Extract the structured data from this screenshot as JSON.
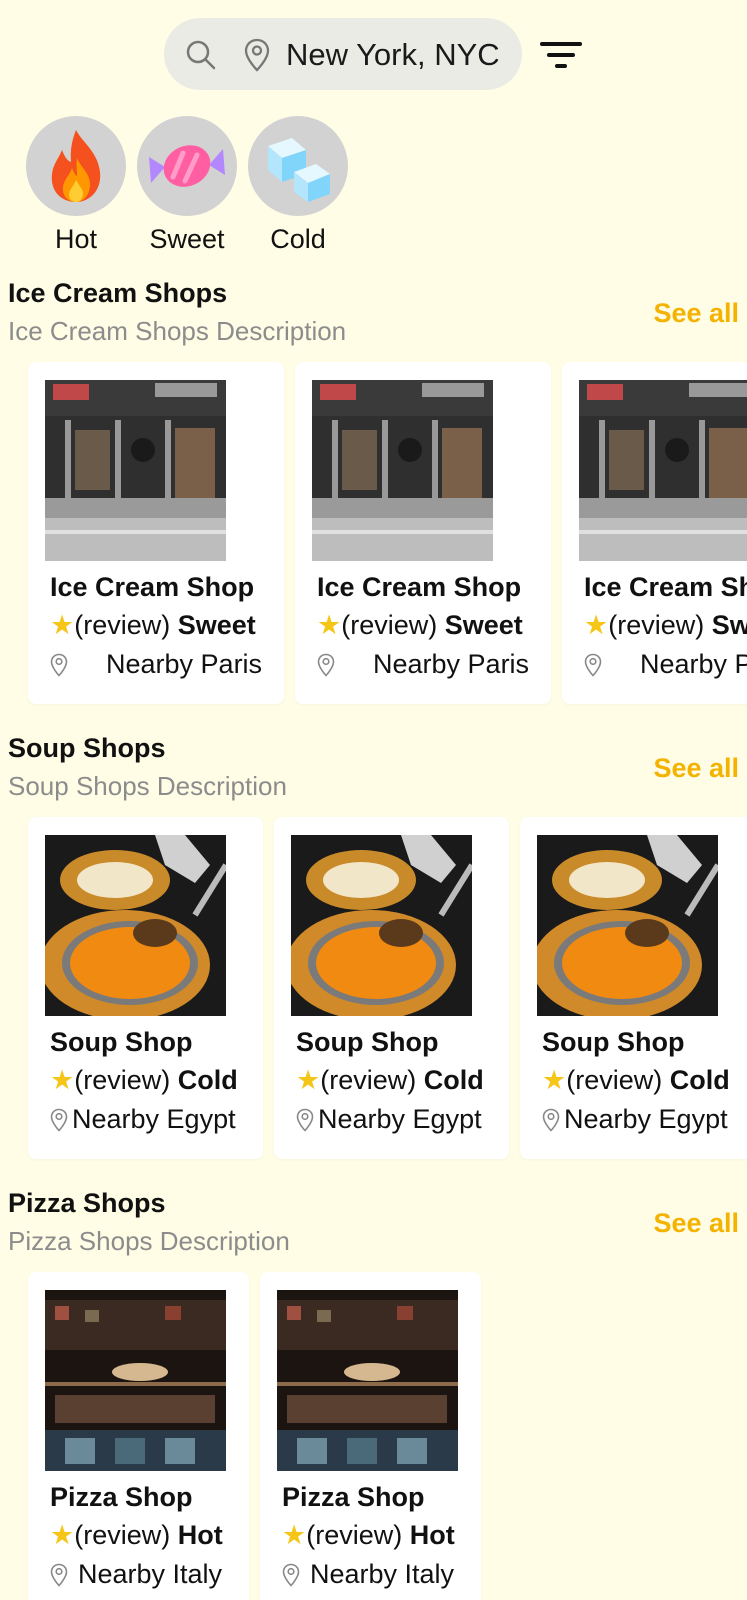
{
  "search": {
    "value": "New York, NYC"
  },
  "categories": [
    {
      "label": "Hot",
      "icon": "fire-icon"
    },
    {
      "label": "Sweet",
      "icon": "candy-icon"
    },
    {
      "label": "Cold",
      "icon": "ice-cube-icon"
    }
  ],
  "sections": {
    "ice_cream": {
      "title": "Ice Cream Shops",
      "description": "Ice Cream Shops Description",
      "see_all": "See all",
      "cards": [
        {
          "name": "Ice Cream Shop",
          "review": "(review)",
          "tag": "Sweet",
          "location": "Nearby Paris"
        },
        {
          "name": "Ice Cream Shop",
          "review": "(review)",
          "tag": "Sweet",
          "location": "Nearby Paris"
        },
        {
          "name": "Ice Cream Shop",
          "review": "(review)",
          "tag": "Sweet",
          "location": "Nearby Paris"
        }
      ]
    },
    "soup": {
      "title": "Soup Shops",
      "description": "Soup Shops Description",
      "see_all": "See all",
      "cards": [
        {
          "name": "Soup Shop",
          "review": "(review)",
          "tag": "Cold",
          "location": "Nearby Egypt"
        },
        {
          "name": "Soup Shop",
          "review": "(review)",
          "tag": "Cold",
          "location": "Nearby Egypt"
        },
        {
          "name": "Soup Shop",
          "review": "(review)",
          "tag": "Cold",
          "location": "Nearby Egypt"
        }
      ]
    },
    "pizza": {
      "title": "Pizza Shops",
      "description": "Pizza Shops Description",
      "see_all": "See all",
      "cards": [
        {
          "name": "Pizza Shop",
          "review": "(review)",
          "tag": "Hot",
          "location": "Nearby Italy"
        },
        {
          "name": "Pizza Shop",
          "review": "(review)",
          "tag": "Hot",
          "location": "Nearby Italy"
        }
      ]
    }
  },
  "colors": {
    "background": "#fffde6",
    "accent": "#f5b301",
    "star": "#f5c518",
    "muted": "#8c8c8c"
  }
}
